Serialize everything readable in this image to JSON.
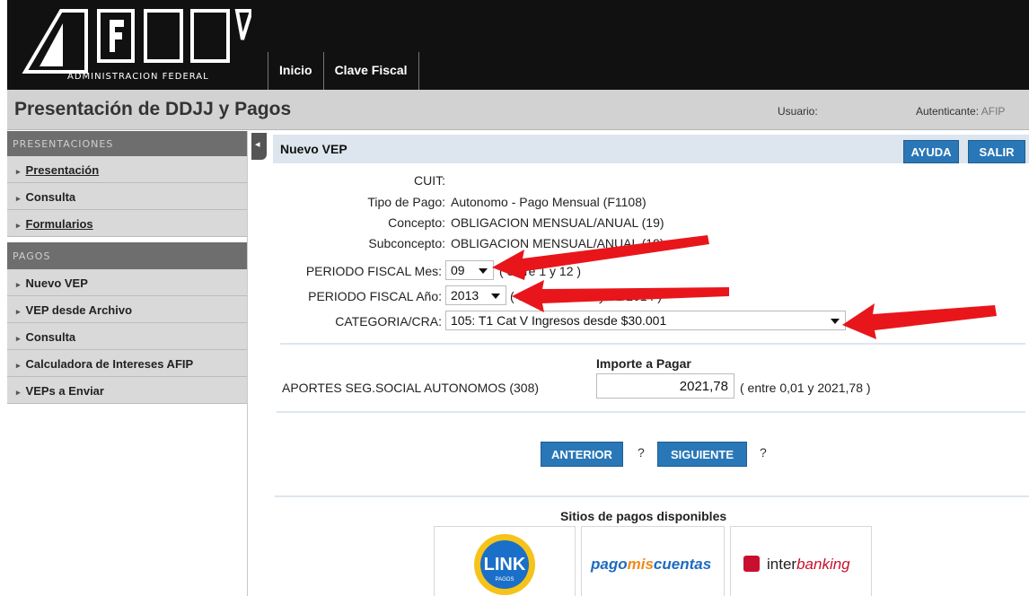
{
  "header": {
    "logo_text": "ADMINISTRACION FEDERAL",
    "nav": [
      "Inicio",
      "Clave Fiscal"
    ]
  },
  "titlebar": {
    "title": "Presentación de DDJJ y Pagos",
    "user_label": "Usuario:",
    "auth_label": "Autenticante:",
    "auth_value": "AFIP"
  },
  "sidebar": {
    "sections": [
      {
        "title": "PRESENTACIONES",
        "items": [
          "Presentación",
          "Consulta",
          "Formularios"
        ]
      },
      {
        "title": "PAGOS",
        "items": [
          "Nuevo VEP",
          "VEP desde Archivo",
          "Consulta",
          "Calculadora de Intereses AFIP",
          "VEPs a Enviar"
        ]
      }
    ]
  },
  "main": {
    "title": "Nuevo VEP",
    "help_button": "AYUDA",
    "exit_button": "SALIR",
    "fields": {
      "cuit_label": "CUIT:",
      "cuit_value": "",
      "tipo_label": "Tipo de Pago:",
      "tipo_value": "Autonomo - Pago Mensual (F1108)",
      "concepto_label": "Concepto:",
      "concepto_value": "OBLIGACION MENSUAL/ANUAL (19)",
      "subconcepto_label": "Subconcepto:",
      "subconcepto_value": "OBLIGACION MENSUAL/ANUAL (19)",
      "mes_label": "PERIODO FISCAL Mes:",
      "mes_value": "09",
      "mes_hint": "( entre 1 y 12 )",
      "anio_label": "PERIODO FISCAL Año:",
      "anio_value": "2013",
      "anio_hint": "( entre 01/1994 y 01/2014 )",
      "cat_label": "CATEGORIA/CRA:",
      "cat_value": "105: T1 Cat V Ingresos desde $30.001"
    },
    "importe": {
      "title": "Importe a Pagar",
      "concept": "APORTES SEG.SOCIAL AUTONOMOS (308)",
      "value": "2021,78",
      "hint": "( entre 0,01 y 2021,78 )"
    },
    "prev_button": "ANTERIOR",
    "next_button": "SIGUIENTE",
    "help_mark": "?",
    "sites_title": "Sitios de pagos disponibles",
    "sites": {
      "link": "LINK",
      "link_sub": "PAGOS",
      "pmc_a": "pago",
      "pmc_b": "mis",
      "pmc_c": "cuentas",
      "ib_a": "inter",
      "ib_b": "banking"
    }
  },
  "colors": {
    "accent_blue": "#2a77b7",
    "annotation_red": "#e8161b"
  }
}
